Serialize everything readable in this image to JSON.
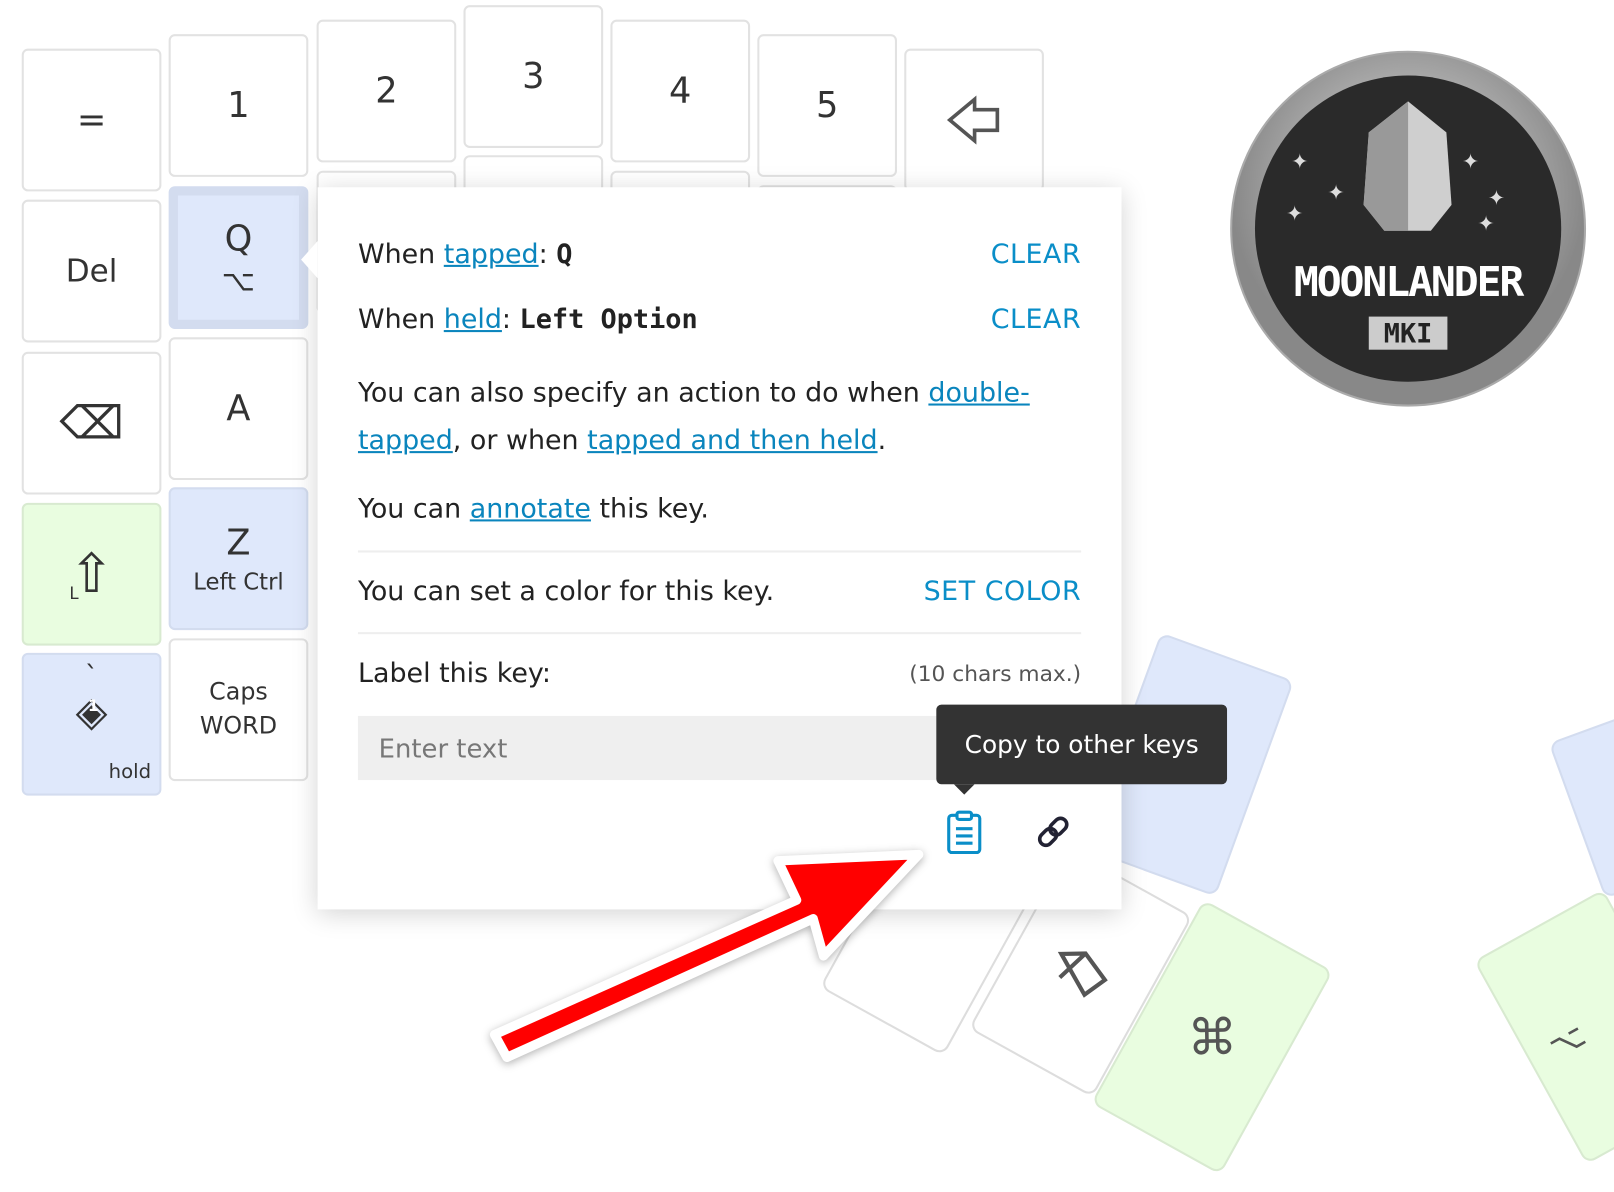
{
  "keys": {
    "equals": "=",
    "one": "1",
    "two": "2",
    "three": "3",
    "four": "4",
    "five": "5",
    "del": "Del",
    "q": "Q",
    "a": "A",
    "z": "Z",
    "z_sub": "Left Ctrl",
    "grave": "`",
    "layer_num": "1",
    "hold": "hold",
    "caps1": "Caps",
    "caps2": "WORD",
    "l_mod": "L"
  },
  "logo": {
    "text": "MOONLANDER",
    "sub": "MKI"
  },
  "popup": {
    "when": "When",
    "tapped_link": "tapped",
    "tapped_value": "Q",
    "held_link": "held",
    "held_value": "Left Option",
    "clear": "CLEAR",
    "also_text": "You can also specify an action to do when",
    "double_link1": "double-",
    "double_link2": "tapped",
    "or_when": ", or when",
    "tap_hold_link": "tapped and then held",
    "period": ".",
    "annotate_pre": "You can",
    "annotate_link": "annotate",
    "annotate_post": "this key.",
    "color_text": "You can set a color for this key.",
    "set_color": "SET COLOR",
    "label_title": "Label this key:",
    "label_hint": "(10 chars max.)",
    "label_placeholder": "Enter text",
    "label_value": ""
  },
  "tooltip": "Copy to other keys",
  "colors": {
    "accent": "#0a85bd",
    "key_blue": "#dfe8fb",
    "key_green": "#e9fde0",
    "tooltip_bg": "#333333",
    "arrow": "#ff0000"
  },
  "icons": [
    "clipboard-icon",
    "link-icon",
    "backspace-icon",
    "shift-icon",
    "option-icon",
    "command-icon",
    "layer-icon",
    "left-arrow-icon"
  ]
}
